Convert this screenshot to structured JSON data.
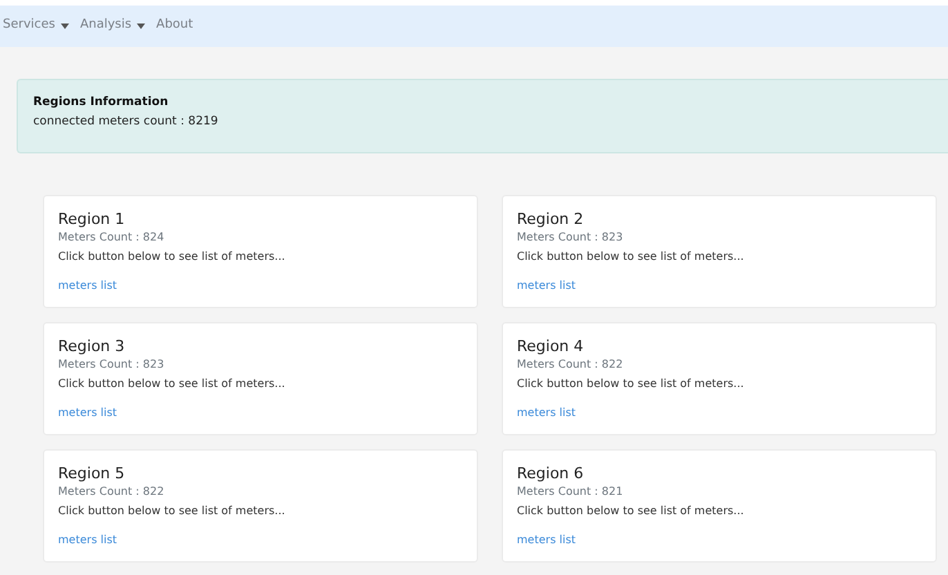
{
  "navbar": {
    "items": [
      {
        "label": "Services",
        "kind": "dropdown"
      },
      {
        "label": "Analysis",
        "kind": "dropdown"
      },
      {
        "label": "About",
        "kind": "link"
      }
    ]
  },
  "info": {
    "title": "Regions Information",
    "text": "connected meters count : 8219"
  },
  "regions": [
    {
      "title": "Region 1",
      "count": "Meters Count : 824",
      "hint": "Click button below to see list of meters...",
      "link": "meters list"
    },
    {
      "title": "Region 2",
      "count": "Meters Count : 823",
      "hint": "Click button below to see list of meters...",
      "link": "meters list"
    },
    {
      "title": "Region 3",
      "count": "Meters Count : 823",
      "hint": "Click button below to see list of meters...",
      "link": "meters list"
    },
    {
      "title": "Region 4",
      "count": "Meters Count : 822",
      "hint": "Click button below to see list of meters...",
      "link": "meters list"
    },
    {
      "title": "Region 5",
      "count": "Meters Count : 822",
      "hint": "Click button below to see list of meters...",
      "link": "meters list"
    },
    {
      "title": "Region 6",
      "count": "Meters Count : 821",
      "hint": "Click button below to see list of meters...",
      "link": "meters list"
    }
  ]
}
